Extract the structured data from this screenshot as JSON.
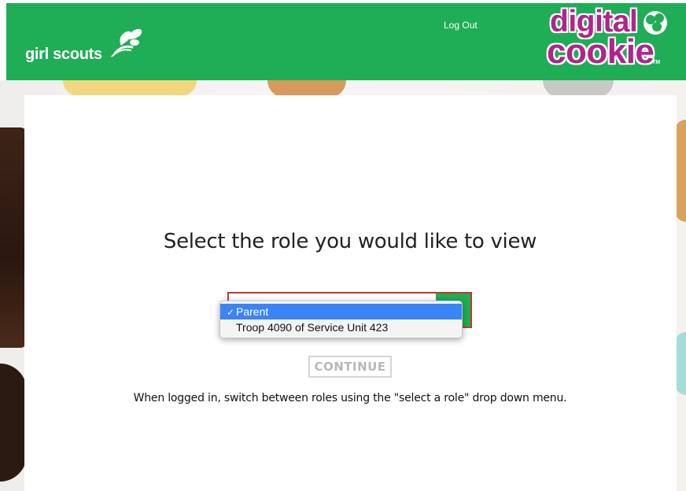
{
  "annotation": "",
  "header": {
    "brand_text": "girl scouts",
    "logout_label": "Log Out",
    "product_logo_line1": "digital",
    "product_logo_line2": "cookie",
    "trademark": "TM",
    "header_color": "#1fad55"
  },
  "main": {
    "heading": "Select the role you would like to view",
    "role_select": {
      "options": [
        {
          "label": "Parent",
          "selected": true
        },
        {
          "label": "Troop 4090 of Service Unit 423",
          "selected": false
        }
      ],
      "check_glyph": "✓"
    },
    "continue_label": "CONTINUE",
    "hint": "When logged in, switch between roles using the \"select a role\" drop down menu."
  },
  "colors": {
    "brand_green": "#1fad55",
    "logo_magenta": "#b0248c",
    "selection_blue": "#3a84f7"
  }
}
